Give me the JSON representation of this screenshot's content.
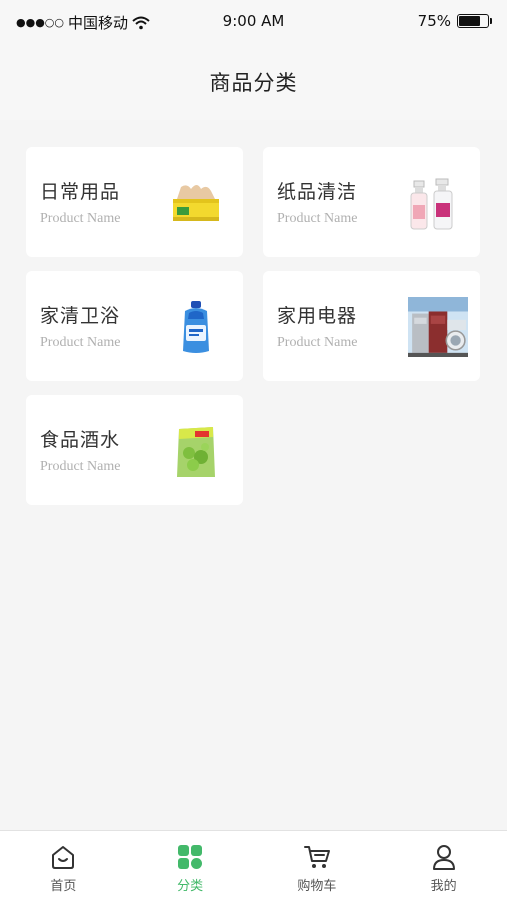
{
  "status_bar": {
    "signal": "●●●○○",
    "carrier": "中国移动",
    "time": "9:00 AM",
    "battery_text": "75%",
    "battery_level": 0.75
  },
  "header": {
    "title": "商品分类"
  },
  "categories": [
    {
      "title": "日常用品",
      "subtitle": "Product Name",
      "icon": "tissue-box-icon"
    },
    {
      "title": "纸品清洁",
      "subtitle": "Product Name",
      "icon": "spray-bottles-icon"
    },
    {
      "title": "家清卫浴",
      "subtitle": "Product Name",
      "icon": "detergent-bottle-icon"
    },
    {
      "title": "家用电器",
      "subtitle": "Product Name",
      "icon": "appliances-icon"
    },
    {
      "title": "食品酒水",
      "subtitle": "Product Name",
      "icon": "snack-pack-icon"
    }
  ],
  "tabbar": {
    "items": [
      {
        "label": "首页",
        "icon": "home-icon",
        "active": false
      },
      {
        "label": "分类",
        "icon": "category-grid-icon",
        "active": true
      },
      {
        "label": "购物车",
        "icon": "cart-icon",
        "active": false
      },
      {
        "label": "我的",
        "icon": "profile-icon",
        "active": false
      }
    ]
  },
  "colors": {
    "accent": "#43b96a",
    "background": "#f5f5f5",
    "card": "#ffffff"
  }
}
